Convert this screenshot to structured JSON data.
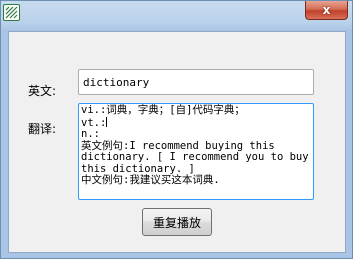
{
  "window": {
    "close_glyph": "x"
  },
  "form": {
    "english_label": "英文:",
    "translation_label": "翻译:",
    "word_value": "dictionary",
    "translation_lines": [
      "vi.:词典，字典；[自]代码字典；",
      "vt.:",
      "n.:",
      "英文例句:I recommend buying this dictionary. [ I recommend you to buy this dictionary. ]",
      "中文例句:我建议买这本词典."
    ],
    "replay_button_label": "重复播放"
  },
  "colors": {
    "title_gradient_top": "#c8dcef",
    "close_button": "#c0402a",
    "focus_border": "#3399ff",
    "client_background": "#f0f0f0"
  },
  "icons": {
    "app": "dictionary-app-icon",
    "close": "close-icon"
  }
}
